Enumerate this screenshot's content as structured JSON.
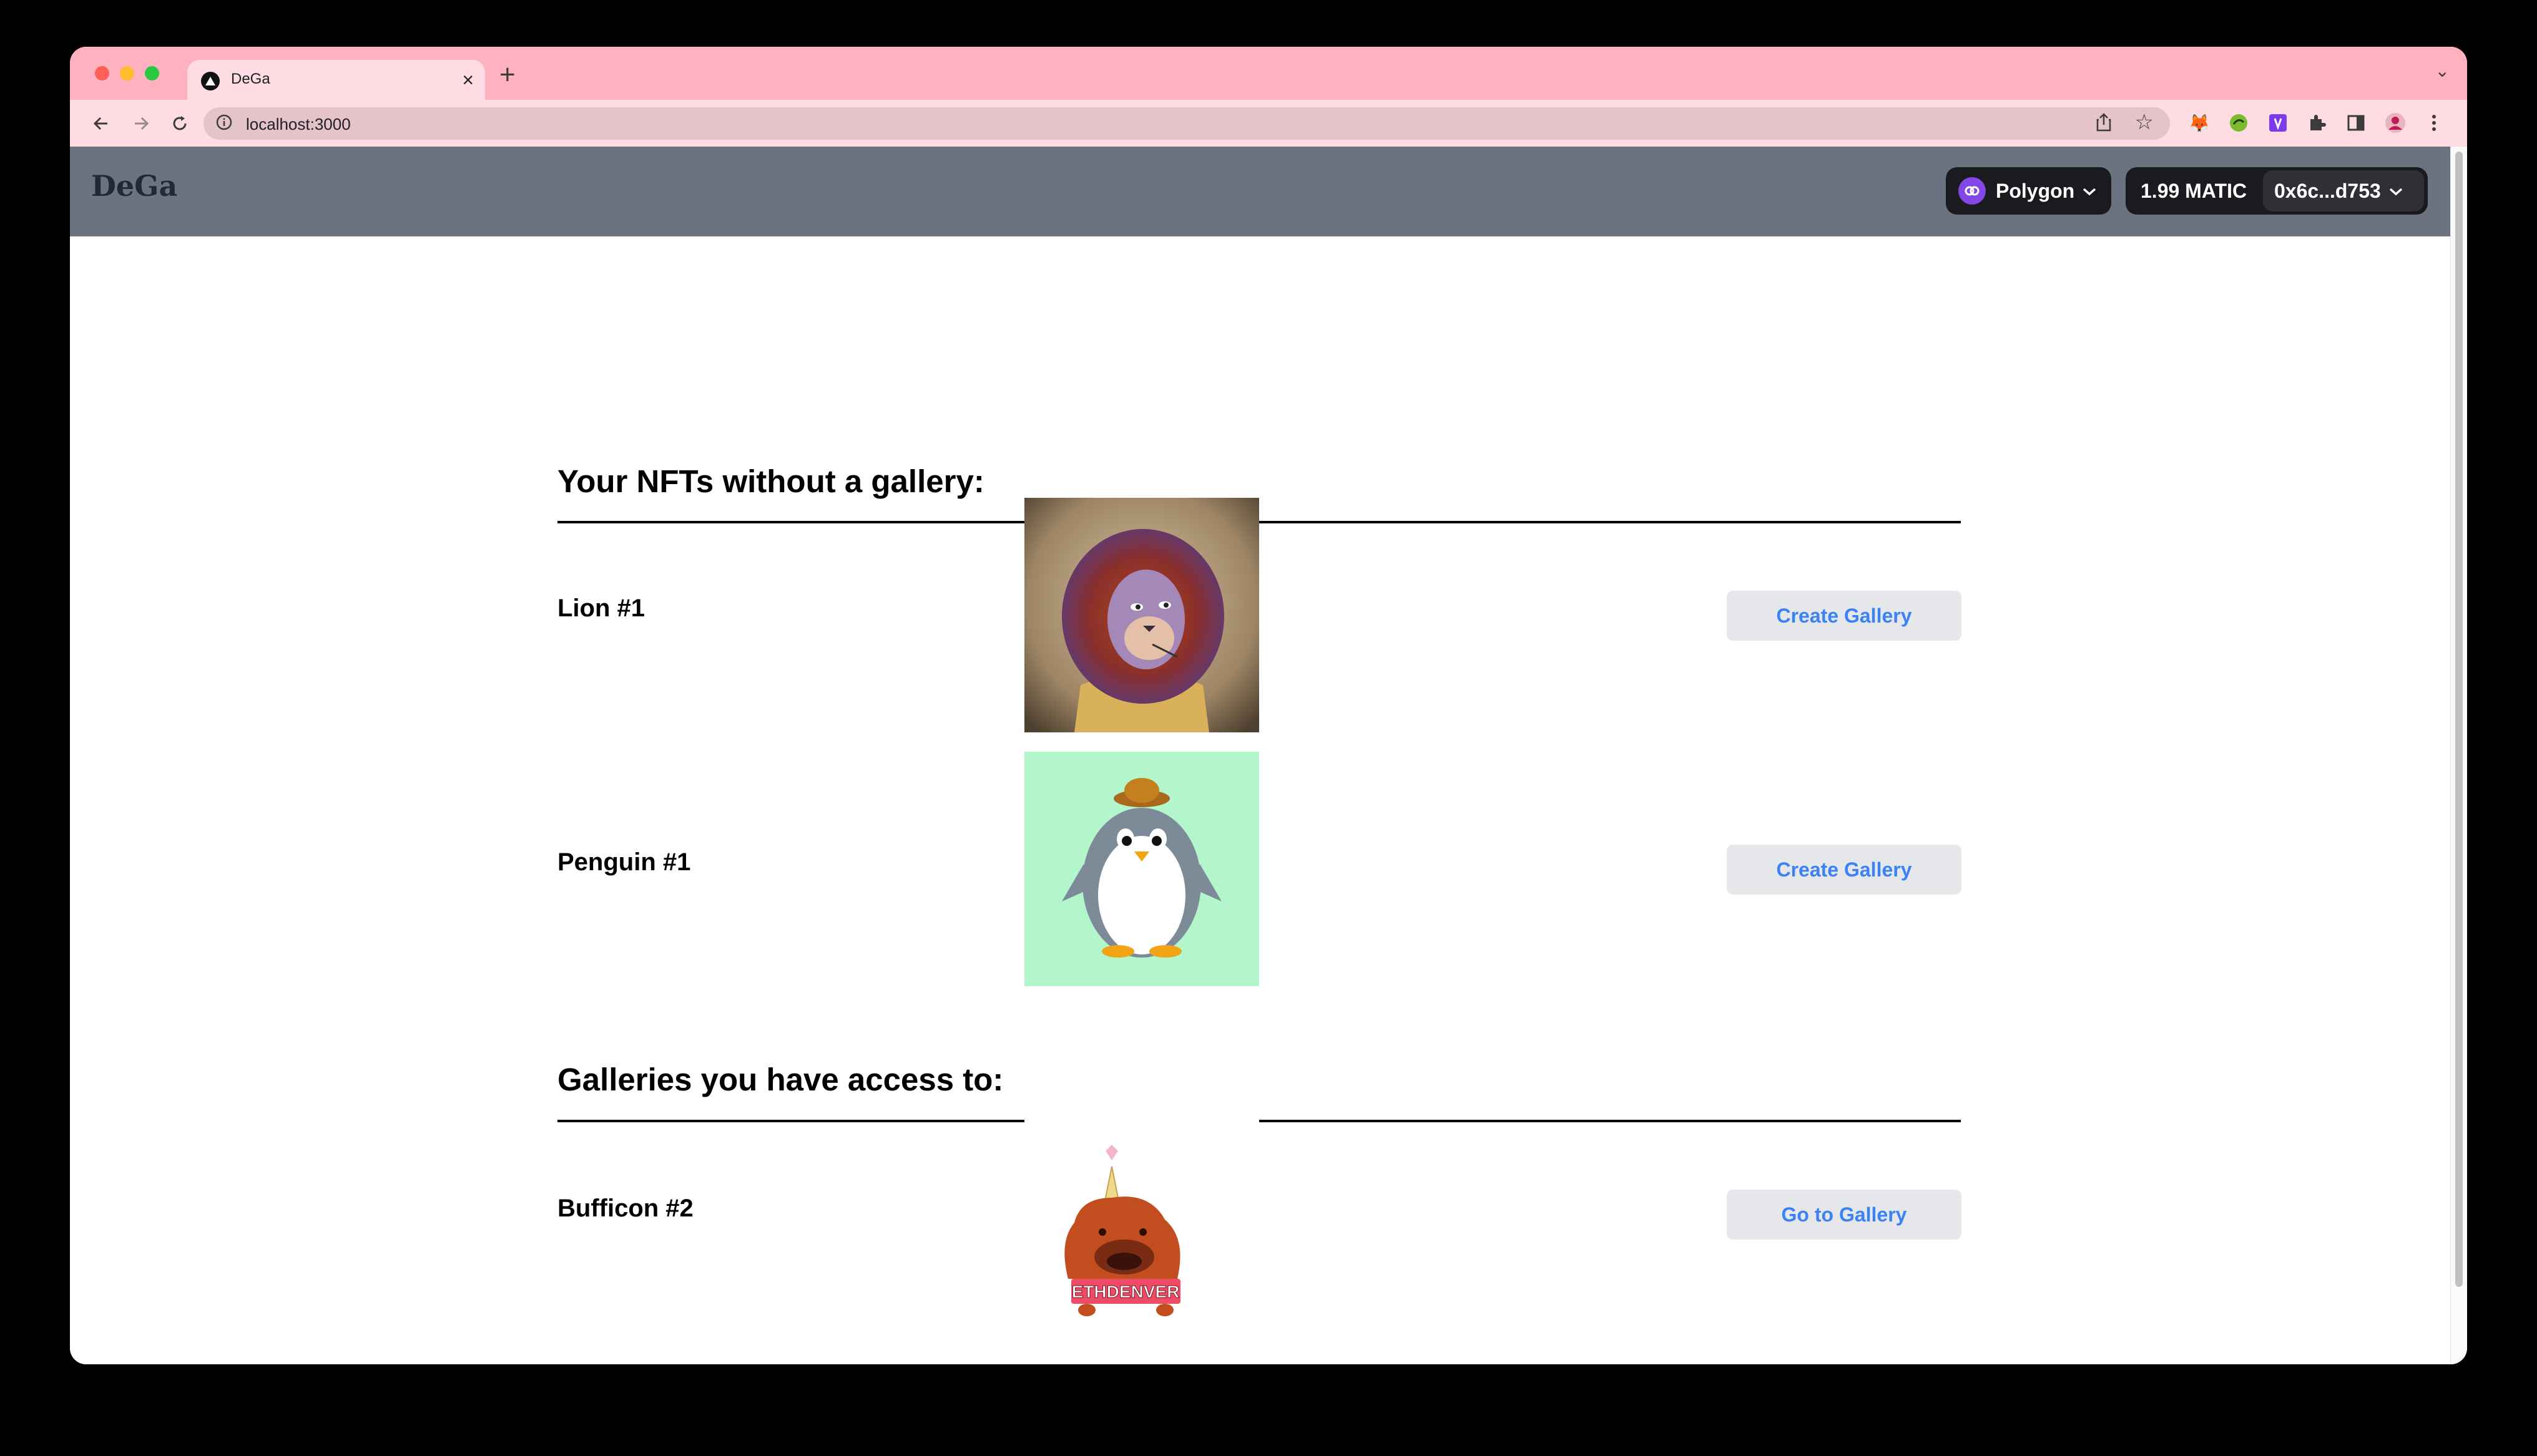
{
  "browser": {
    "tab_title": "DeGa",
    "tab_close": "×",
    "new_tab": "+",
    "tab_menu": "⌄",
    "url": "localhost:3000"
  },
  "app": {
    "logo": "DeGa",
    "network_label": "Polygon",
    "balance": "1.99 MATIC",
    "address": "0x6c...d753"
  },
  "sections": [
    {
      "title": "Your NFTs without a gallery:",
      "items": [
        {
          "name": "Lion #1",
          "action": "Create Gallery",
          "image": "lion-nft"
        },
        {
          "name": "Penguin #1",
          "action": "Create Gallery",
          "image": "penguin-nft"
        }
      ]
    },
    {
      "title": "Galleries you have access to:",
      "items": [
        {
          "name": "Bufficon #2",
          "action": "Go to Gallery",
          "image": "bufficon-nft",
          "banner_text": "ETHDENVER"
        }
      ]
    }
  ],
  "colors": {
    "tab_strip": "#ffb1bf",
    "toolbar": "#ffdce3",
    "app_header": "#6b7280",
    "button_text": "#3b82f6",
    "button_bg": "#e5e7eb",
    "polygon_purple": "#8247e5"
  }
}
